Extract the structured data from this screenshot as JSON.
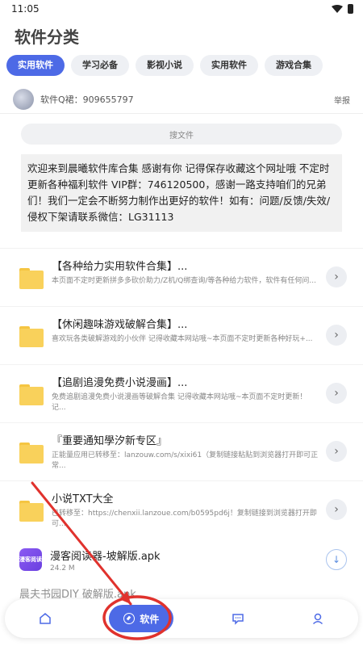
{
  "status_bar": {
    "time": "11:05"
  },
  "page_title": "软件分类",
  "tabs": [
    {
      "label": "实用软件",
      "active": true
    },
    {
      "label": "学习必备",
      "active": false
    },
    {
      "label": "影视小说",
      "active": false
    },
    {
      "label": "实用软件",
      "active": false
    },
    {
      "label": "游戏合集",
      "active": false
    }
  ],
  "qq_row": {
    "text": "软件Q裙：909655797",
    "report": "举报"
  },
  "search": {
    "placeholder": "搜文件"
  },
  "notice": "欢迎来到晨曦软件库合集 感谢有你 记得保存收藏这个网址哦 不定时更新各种福利软件 VIP群：746120500，感谢一路支持咱们的兄弟们！我们一定会不断努力制作出更好的软件！如有：问题/反馈/失效/侵权下架请联系微信：LG31113",
  "files": [
    {
      "title": "【各种给力实用软件合集】...",
      "desc": "本页面不定时更新拼多多砍价助力/Z机/Q绑查询/等各种给力软件，软件有任何问..."
    },
    {
      "title": "【休闲趣味游戏破解合集】...",
      "desc": "喜欢玩各类破解游戏的小伙伴 记得收藏本网站哦~本页面不定时更新各种好玩+..."
    },
    {
      "title": "【追剧追漫免费小说漫画】...",
      "desc": "免费追剧追漫免费小说漫画等破解合集 记得收藏本网站哦~本页面不定时更新！记..."
    },
    {
      "title": "『重要通知學汐新专区』",
      "desc": "正能量应用已转移至：lanzouw.com/s/xixi61（复制链接粘贴到浏览器打开即可正常..."
    },
    {
      "title": "小说TXT大全",
      "desc": "已转移至：https://chenxii.lanzoue.com/b0595pd6j！复制链接到浏览器打开即可..."
    }
  ],
  "apk": {
    "title": "漫客阅读器-坡解版.apk",
    "size": "24.2 M",
    "icon_text": "漫客阅读"
  },
  "partial_item": "晨夫书园DIY 破解版.apk",
  "bottom_nav": {
    "active_label": "软件"
  }
}
